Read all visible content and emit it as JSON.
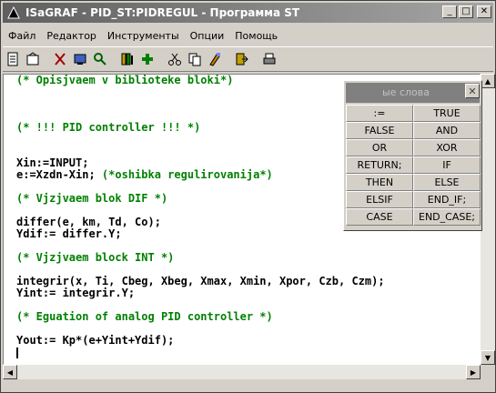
{
  "window": {
    "title": "ISaGRAF - PID_ST:PIDREGUL - Программа ST",
    "minimize_glyph": "_",
    "maximize_glyph": "□",
    "close_glyph": "✕"
  },
  "menu": [
    "Файл",
    "Редактор",
    "Инструменты",
    "Опции",
    "Помощь"
  ],
  "toolbar": {
    "groups": [
      [
        "new-document-icon",
        "open-document-icon"
      ],
      [
        "cut-icon",
        "dictionary-icon",
        "search-icon"
      ],
      [
        "library-icon",
        "spy-icon"
      ],
      [
        "scissors-icon",
        "copy-icon",
        "paste-icon"
      ],
      [
        "exit-icon"
      ],
      [
        "print-icon"
      ]
    ]
  },
  "editor": {
    "lines": [
      {
        "t": "(* Opisjvaem v biblioteke bloki*)",
        "c": true
      },
      {
        "t": "",
        "c": false
      },
      {
        "t": "",
        "c": false
      },
      {
        "t": "",
        "c": false
      },
      {
        "t": "(* !!! PID controller !!! *)",
        "c": true
      },
      {
        "t": "",
        "c": false
      },
      {
        "t": "",
        "c": false
      },
      {
        "t": "Xin:=INPUT;",
        "c": false
      },
      {
        "t": "e:=Xzdn-Xin;",
        "c": false,
        "tail": " (*oshibka regulirovanija*)"
      },
      {
        "t": "",
        "c": false
      },
      {
        "t": "(* Vjzjvaem blok DIF *)",
        "c": true
      },
      {
        "t": "",
        "c": false
      },
      {
        "t": "differ(e, km, Td, Co);",
        "c": false
      },
      {
        "t": "Ydif:= differ.Y;",
        "c": false
      },
      {
        "t": "",
        "c": false
      },
      {
        "t": "(* Vjzjvaem block INT *)",
        "c": true
      },
      {
        "t": "",
        "c": false
      },
      {
        "t": "integrir(x, Ti, Cbeg, Xbeg, Xmax, Xmin, Xpor, Czb, Czm);",
        "c": false
      },
      {
        "t": "Yint:= integrir.Y;",
        "c": false
      },
      {
        "t": "",
        "c": false
      },
      {
        "t": "(* Eguation of analog PID controller *)",
        "c": true
      },
      {
        "t": "",
        "c": false
      },
      {
        "t": "Yout:= Kp*(e+Yint+Ydif);",
        "c": false
      },
      {
        "t": "",
        "c": false
      }
    ]
  },
  "keywords_panel": {
    "title": "ые слова",
    "close_glyph": "✕",
    "items": [
      ":=",
      "TRUE",
      "FALSE",
      "AND",
      "OR",
      "XOR",
      "RETURN;",
      "IF",
      "THEN",
      "ELSE",
      "ELSIF",
      "END_IF;",
      "CASE",
      "END_CASE;"
    ]
  },
  "colors": {
    "comment": "#008000",
    "code": "#000000"
  }
}
